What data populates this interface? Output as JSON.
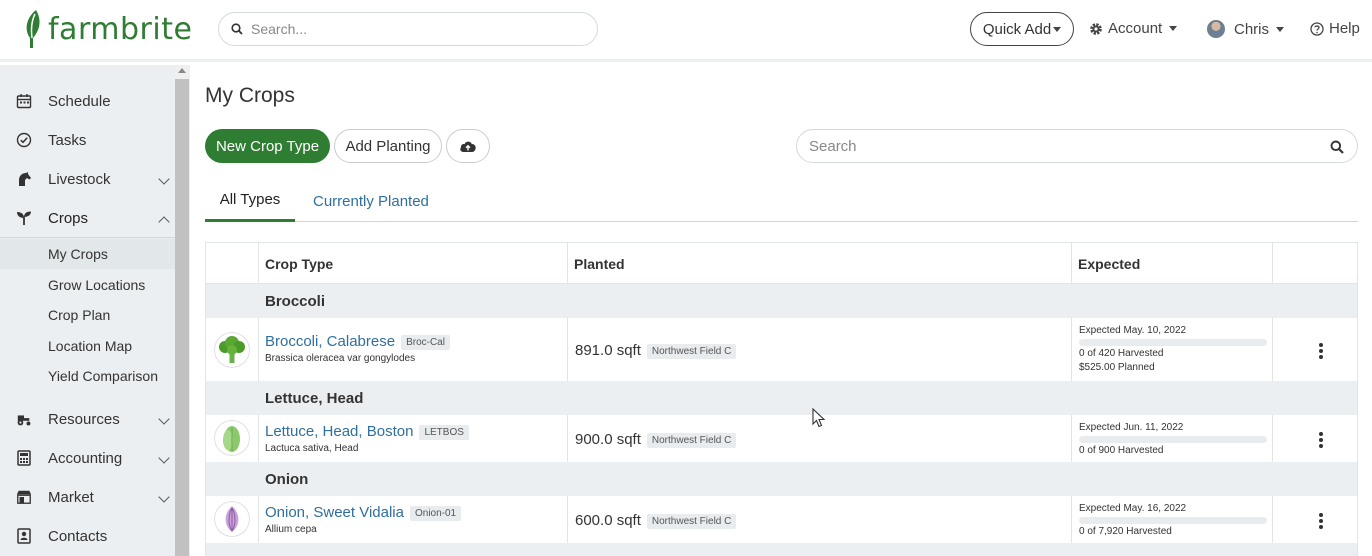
{
  "header": {
    "logo_text": "farmbrite",
    "search_placeholder": "Search...",
    "quick_add_label": "Quick Add",
    "account_label": "Account",
    "user_label": "Chris",
    "help_label": "Help"
  },
  "sidebar": {
    "items": [
      {
        "label": "Schedule",
        "icon": "calendar-icon"
      },
      {
        "label": "Tasks",
        "icon": "check-circle-icon"
      },
      {
        "label": "Livestock",
        "icon": "horse-icon"
      },
      {
        "label": "Crops",
        "icon": "sprout-icon"
      },
      {
        "label": "Resources",
        "icon": "tractor-icon"
      },
      {
        "label": "Accounting",
        "icon": "calculator-icon"
      },
      {
        "label": "Market",
        "icon": "store-icon"
      },
      {
        "label": "Contacts",
        "icon": "contact-icon"
      }
    ],
    "crops_sub": [
      "My Crops",
      "Grow Locations",
      "Crop Plan",
      "Location Map",
      "Yield Comparison"
    ]
  },
  "main": {
    "title": "My Crops",
    "new_crop_type": "New Crop Type",
    "add_planting": "Add Planting",
    "search_placeholder": "Search",
    "tabs": [
      "All Types",
      "Currently Planted"
    ],
    "columns": [
      "Crop Type",
      "Planted",
      "Expected"
    ]
  },
  "groups": [
    {
      "name": "Broccoli",
      "crop": {
        "name": "Broccoli, Calabrese",
        "code": "Broc-Cal",
        "scientific": "Brassica oleracea var gongylodes",
        "planted_area": "891.0 sqft",
        "location": "Northwest Field C",
        "expected_date": "Expected May. 10, 2022",
        "harvested": "0 of 420 Harvested",
        "planned": "$525.00 Planned",
        "harvest_fraction": 0
      }
    },
    {
      "name": "Lettuce, Head",
      "crop": {
        "name": "Lettuce, Head, Boston",
        "code": "LETBOS",
        "scientific": "Lactuca sativa, Head",
        "planted_area": "900.0 sqft",
        "location": "Northwest Field C",
        "expected_date": "Expected Jun. 11, 2022",
        "harvested": "0 of 900 Harvested",
        "harvest_fraction": 0
      }
    },
    {
      "name": "Onion",
      "crop": {
        "name": "Onion, Sweet Vidalia",
        "code": "Onion-01",
        "scientific": "Allium cepa",
        "planted_area": "600.0 sqft",
        "location": "Northwest Field C",
        "expected_date": "Expected May. 16, 2022",
        "harvested": "0 of 7,920 Harvested",
        "harvest_fraction": 0
      }
    }
  ],
  "colors": {
    "brand_green": "#2e7d32",
    "link_blue": "#2f6f9f",
    "sidebar_bg": "#eceff1"
  }
}
